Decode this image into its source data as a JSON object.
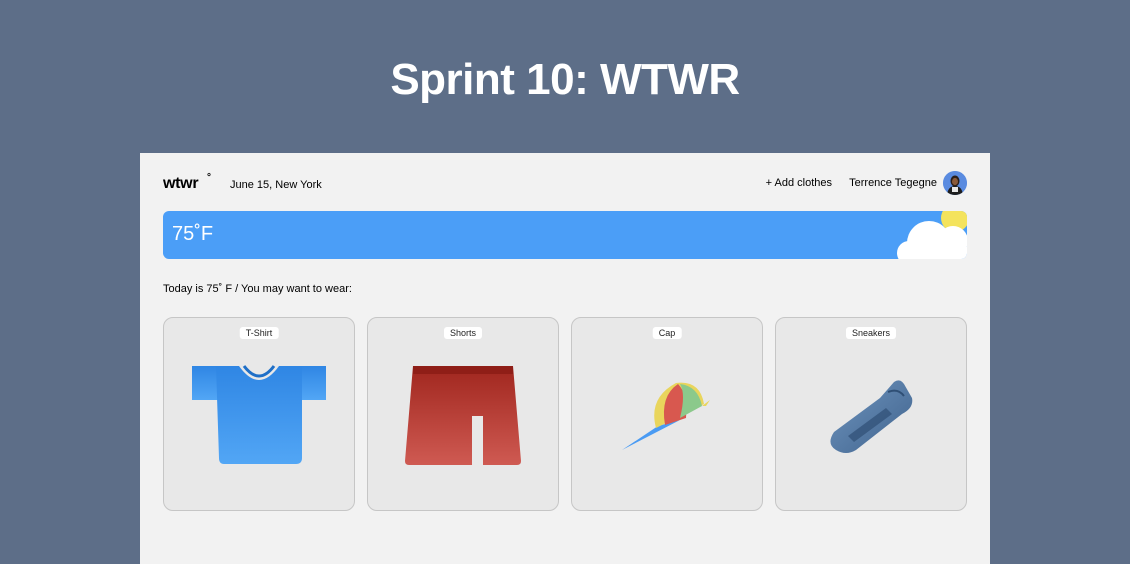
{
  "page": {
    "title": "Sprint 10: WTWR"
  },
  "header": {
    "logo": "wtwr",
    "logo_mark": "°",
    "date_location": "June 15, New York",
    "add_clothes": "+ Add clothes",
    "user_name": "Terrence Tegegne"
  },
  "weather": {
    "temperature": "75˚F",
    "icon": "sun-cloud-icon"
  },
  "main": {
    "recommendation": "Today is 75˚ F / You may want to wear:",
    "items": [
      {
        "label": "T-Shirt",
        "icon": "tshirt-icon",
        "color": "#4a9bf3"
      },
      {
        "label": "Shorts",
        "icon": "shorts-icon",
        "color": "#b8332a"
      },
      {
        "label": "Cap",
        "icon": "cap-icon",
        "color": "#e9d55c"
      },
      {
        "label": "Sneakers",
        "icon": "sneakers-icon",
        "color": "#4f77a3"
      }
    ]
  },
  "colors": {
    "background": "#5d6e88",
    "app_background": "#f2f2f2",
    "weather_blue": "#4b9ef7",
    "card_background": "#e8e8e8"
  }
}
